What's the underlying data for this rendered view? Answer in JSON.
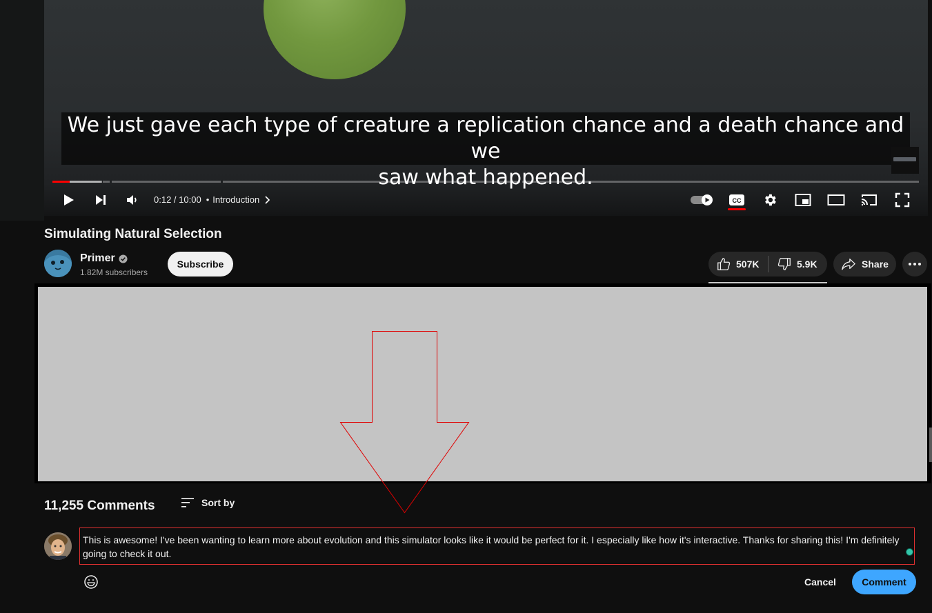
{
  "player": {
    "caption_line1": "We just gave each type of creature a replication chance and a death chance and we",
    "caption_line2": "saw what happened.",
    "current_time": "0:12",
    "duration": "10:00",
    "time_separator": " / ",
    "chapter_separator": "•",
    "chapter": "Introduction",
    "progress_played_fraction": 0.02,
    "progress_buffered_fraction": 0.057,
    "autoplay_on": true,
    "captions_on": true,
    "accent_color": "#ff0000",
    "icons": [
      "play-icon",
      "next-icon",
      "volume-icon",
      "chevron-right-icon",
      "autoplay-toggle",
      "cc-icon",
      "gear-icon",
      "miniplayer-icon",
      "theater-icon",
      "cast-icon",
      "fullscreen-icon"
    ]
  },
  "video": {
    "title": "Simulating Natural Selection"
  },
  "channel": {
    "name": "Primer",
    "verified": true,
    "subscribers": "1.82M subscribers",
    "subscribe_label": "Subscribe"
  },
  "actions": {
    "likes": "507K",
    "dislikes": "5.9K",
    "share_label": "Share"
  },
  "comments": {
    "count_label": "11,255 Comments",
    "sort_label": "Sort by",
    "draft_text": "This is awesome! I've been wanting to learn more about evolution and this simulator looks like it would be perfect for it. I especially like how it's interactive. Thanks for sharing this! I'm definitely going to check it out.",
    "cancel_label": "Cancel",
    "submit_label": "Comment",
    "submit_color": "#3ea6ff"
  },
  "overlay": {
    "panel_color": "#c4c4c4",
    "arrow_color": "#e00000"
  }
}
